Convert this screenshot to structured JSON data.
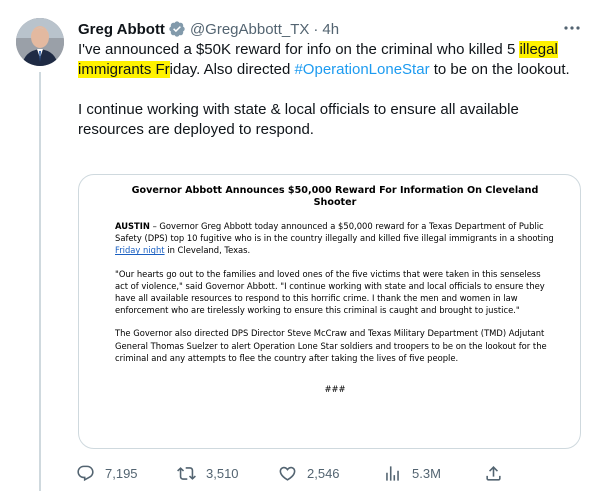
{
  "tweet": {
    "author_name": "Greg Abbott",
    "handle": "@GregAbbott_TX",
    "separator": "·",
    "timestamp": "4h",
    "body": {
      "p1_before": "I've announced a $50K reward for info on the criminal who killed 5 ",
      "p1_highlight": "illegal immigrants Fr",
      "p1_middle": "iday. Also directed ",
      "p1_hashtag": "#OperationLoneStar",
      "p1_after": " to be on the lookout.",
      "p2": "I continue working with state & local officials to ensure all available resources are deployed to respond."
    },
    "colors": {
      "highlight": "#fff200",
      "link": "#1d9bf0",
      "verified": "#829aab",
      "secondary_text": "#536471"
    },
    "icons": {
      "verified": "verified-badge-icon",
      "more": "more-options-icon",
      "reply": "reply-icon",
      "retweet": "retweet-icon",
      "like": "like-icon",
      "views": "views-icon",
      "share": "share-icon"
    }
  },
  "press_release": {
    "title": "Governor Abbott Announces $50,000 Reward For Information On Cleveland Shooter",
    "dateline": "AUSTIN",
    "p1_text": " – Governor Greg Abbott today announced a $50,000 reward for a Texas Department of Public Safety (DPS) top 10 fugitive who is in the country illegally and killed five illegal immigrants in a shooting ",
    "p1_link": "Friday night",
    "p1_end": " in Cleveland, Texas.",
    "p2": "\"Our hearts go out to the families and loved ones of the five victims that were taken in this senseless act of violence,\" said Governor Abbott. \"I continue working with state and local officials to ensure they have all available resources to respond to this horrific crime. I thank the men and women in law enforcement who are tirelessly working to ensure this criminal is caught and brought to justice.\"",
    "p3": "The Governor also directed DPS Director Steve McCraw and Texas Military Department (TMD) Adjutant General Thomas Suelzer to alert Operation Lone Star soldiers and troopers to be on the lookout for the criminal and any attempts to flee the country after taking the lives of five people.",
    "end_mark": "###"
  },
  "actions": {
    "replies": "7,195",
    "retweets": "3,510",
    "likes": "2,546",
    "views": "5.3M"
  }
}
